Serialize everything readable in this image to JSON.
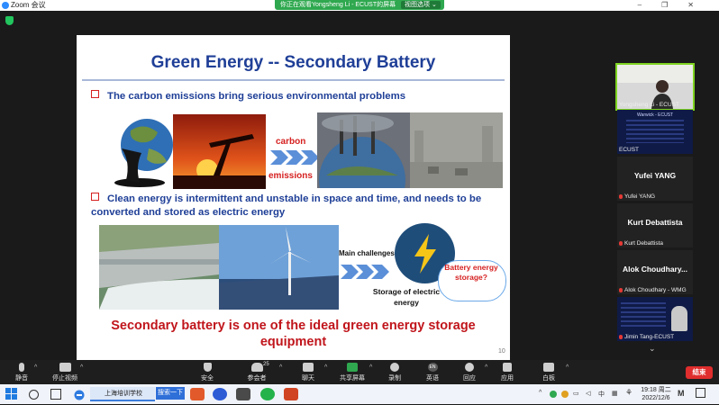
{
  "window": {
    "app_title": "Zoom 会议"
  },
  "share_banner": {
    "text": "你正在观看Yongsheng Li - ECUST的屏幕",
    "options_label": "视图选项"
  },
  "slide": {
    "title": "Green Energy -- Secondary Battery",
    "bullet1": "The carbon emissions bring serious environmental problems",
    "carbon_label": "carbon",
    "emissions_label": "emissions",
    "bullet2": "Clean energy is intermittent and unstable in space and time, and needs to be converted and stored as electric energy",
    "main_challenges": "Main challenges",
    "storage_label": "Storage of electric energy",
    "callout": "Battery energy storage?",
    "conclusion": "Secondary battery is one of the ideal green energy storage equipment",
    "page_number": "10"
  },
  "participants": [
    {
      "caption": "Yongsheng Li - ECUST",
      "big_name": "",
      "muted": false,
      "active": true
    },
    {
      "caption": "ECUST",
      "big_name": "",
      "muted": false,
      "active": false
    },
    {
      "caption": "Yufei YANG",
      "big_name": "Yufei YANG",
      "muted": true,
      "active": false
    },
    {
      "caption": "Kurt Debattista",
      "big_name": "Kurt Debattista",
      "muted": true,
      "active": false
    },
    {
      "caption": "Alok Choudhary - WMG",
      "big_name": "Alok Choudhary...",
      "muted": true,
      "active": false
    },
    {
      "caption": "Jimin Tang-ECUST",
      "big_name": "",
      "muted": true,
      "active": false
    }
  ],
  "slide_thumb_text": {
    "line1": "Warwick - ECUST"
  },
  "toolbar": {
    "mute": "静音",
    "stop_video": "停止视频",
    "security": "安全",
    "participants": "参会者",
    "participants_count": "25",
    "chat": "聊天",
    "share_screen": "共享屏幕",
    "record": "录制",
    "language": "英语",
    "language_icon_text": "EN",
    "reactions": "回应",
    "apps": "应用",
    "whiteboard": "白板",
    "end": "结束"
  },
  "taskbar": {
    "task_label": "上海培训学校",
    "search_label": "搜索一下",
    "tray_lang": "中",
    "time": "19:18 周二",
    "date": "2022/12/6"
  },
  "colors": {
    "title_blue": "#1f3f97",
    "accent_red": "#d62020",
    "share_green": "#2fa84f",
    "active_speaker": "#7ed321",
    "end_red": "#e02d2d"
  }
}
